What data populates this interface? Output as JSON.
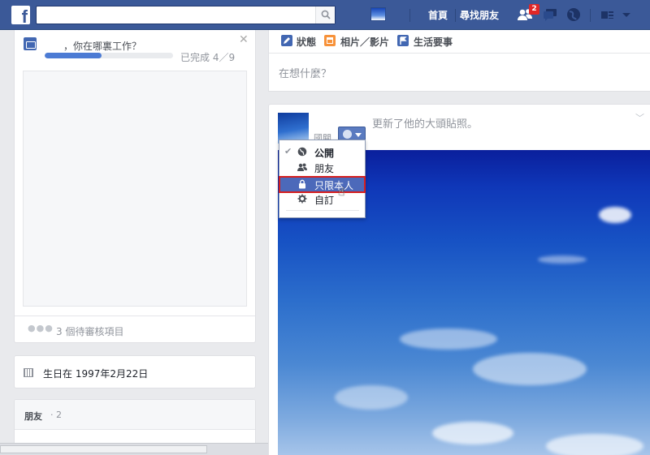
{
  "topbar": {
    "logo": "f",
    "search_placeholder": "",
    "nav": [
      "首頁",
      "尋找朋友"
    ],
    "friend_requests_badge": "2"
  },
  "left": {
    "work_question": "，你在哪裏工作？",
    "progress_text": "已完成 4／9",
    "progress_fraction": 0.444,
    "pending_text": "3 個待審核項目",
    "birthday_text": "生日在 1997年2月22日",
    "friends_title": "朋友",
    "friends_count": "· 2"
  },
  "composer": {
    "tabs": [
      "狀態",
      "相片／影片",
      "生活要事"
    ],
    "placeholder": "在想什麼？"
  },
  "post": {
    "author": "國關",
    "action_text": "更新了他的大頭貼照。"
  },
  "privacy_menu": {
    "items": [
      {
        "label": "公開",
        "icon": "globe-icon",
        "selected": true
      },
      {
        "label": "朋友",
        "icon": "friends-icon",
        "selected": false
      },
      {
        "label": "只限本人",
        "icon": "lock-icon",
        "selected": false,
        "hover": true
      },
      {
        "label": "自訂",
        "icon": "gear-icon",
        "selected": false
      }
    ]
  },
  "colors": {
    "brand": "#3b5998",
    "highlight": "#4c69ba",
    "annotation": "#d61f1f"
  }
}
